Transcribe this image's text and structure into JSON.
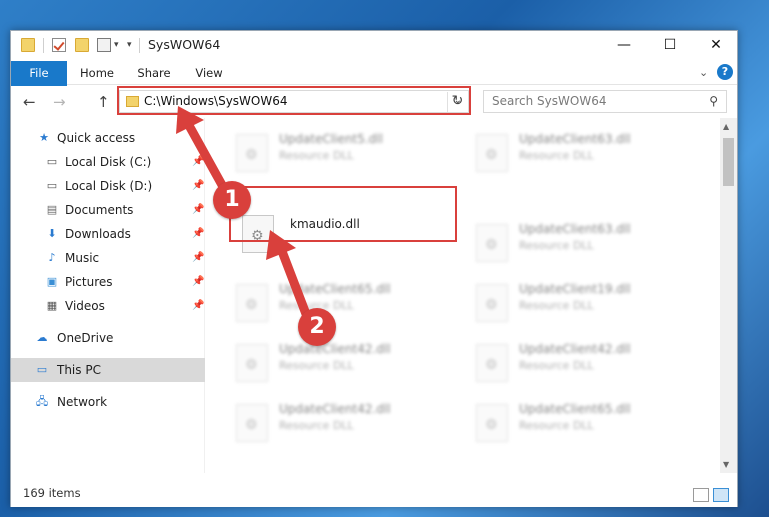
{
  "title_bar": {
    "title": "SysWOW64",
    "minimize": "—",
    "maximize": "☐",
    "close": "✕"
  },
  "ribbon": {
    "tabs": [
      "File",
      "Home",
      "Share",
      "View"
    ],
    "expand": "⌄",
    "help": "?"
  },
  "nav": {
    "back": "←",
    "forward": "→",
    "up": "↑"
  },
  "address": {
    "path": "C:\\Windows\\SysWOW64",
    "dropdown": "⌄",
    "refresh": "↻"
  },
  "search": {
    "placeholder": "Search SysWOW64",
    "icon": "search-icon"
  },
  "sidebar": {
    "items": [
      {
        "label": "Quick access",
        "icon": "star-icon",
        "pinned": false
      },
      {
        "label": "Local Disk (C:)",
        "icon": "drive-icon",
        "pinned": true
      },
      {
        "label": "Local Disk (D:)",
        "icon": "drive-icon",
        "pinned": true
      },
      {
        "label": "Documents",
        "icon": "documents-icon",
        "pinned": true
      },
      {
        "label": "Downloads",
        "icon": "download-icon",
        "pinned": true
      },
      {
        "label": "Music",
        "icon": "music-icon",
        "pinned": true
      },
      {
        "label": "Pictures",
        "icon": "pictures-icon",
        "pinned": true
      },
      {
        "label": "Videos",
        "icon": "videos-icon",
        "pinned": true
      },
      {
        "label": "OneDrive",
        "icon": "cloud-icon",
        "pinned": false
      },
      {
        "label": "This PC",
        "icon": "computer-icon",
        "pinned": false,
        "selected": true
      },
      {
        "label": "Network",
        "icon": "network-icon",
        "pinned": false
      }
    ]
  },
  "files": {
    "left": [
      {
        "name": "UpdateClient5.dll",
        "type": "Resource DLL",
        "blurred": true
      },
      {
        "name": "kmaudio.dll",
        "type": "",
        "blurred": false,
        "highlighted": true
      },
      {
        "name": "UpdateClient65.dll",
        "type": "Resource DLL",
        "blurred": true
      },
      {
        "name": "UpdateClient42.dll",
        "type": "Resource DLL",
        "blurred": true
      },
      {
        "name": "UpdateClient42.dll",
        "type": "Resource DLL",
        "blurred": true
      }
    ],
    "right": [
      {
        "name": "UpdateClient63.dll",
        "type": "Resource DLL",
        "blurred": true
      },
      {
        "name": "UpdateClient63.dll",
        "type": "Resource DLL",
        "blurred": true
      },
      {
        "name": "UpdateClient19.dll",
        "type": "Resource DLL",
        "blurred": true
      },
      {
        "name": "UpdateClient42.dll",
        "type": "Resource DLL",
        "blurred": true
      },
      {
        "name": "UpdateClient65.dll",
        "type": "Resource DLL",
        "blurred": true
      }
    ]
  },
  "status": {
    "item_count": "169 items"
  },
  "annotations": {
    "step1": "1",
    "step2": "2",
    "color": "#d9403c"
  },
  "colors": {
    "accent": "#1979ca",
    "highlight": "#d9403c"
  }
}
